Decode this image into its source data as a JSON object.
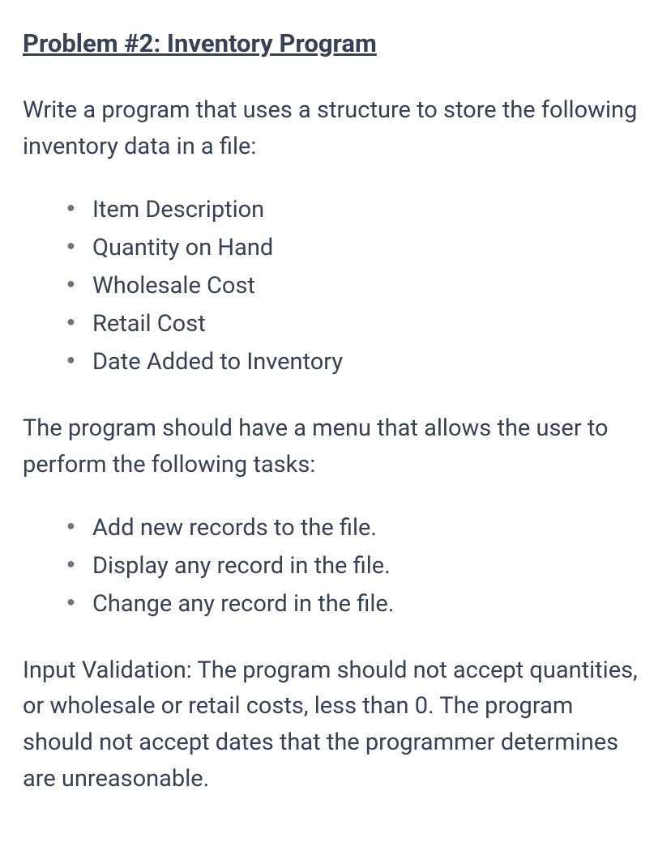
{
  "heading": "Problem #2: Inventory Program",
  "intro": "Write a program that uses a structure to store the following inventory data in a file:",
  "fields": [
    "Item Description",
    "Quantity on Hand",
    "Wholesale Cost",
    "Retail Cost",
    "Date Added to Inventory"
  ],
  "menuIntro": "The program should have a menu that allows the user to perform the following tasks:",
  "tasks": [
    "Add new records to the file.",
    "Display any record in the file.",
    "Change any record in the file."
  ],
  "validation": "Input Validation: The program should not accept quantities, or wholesale or retail costs, less than 0. The program should not accept dates that the programmer determines are unreasonable."
}
